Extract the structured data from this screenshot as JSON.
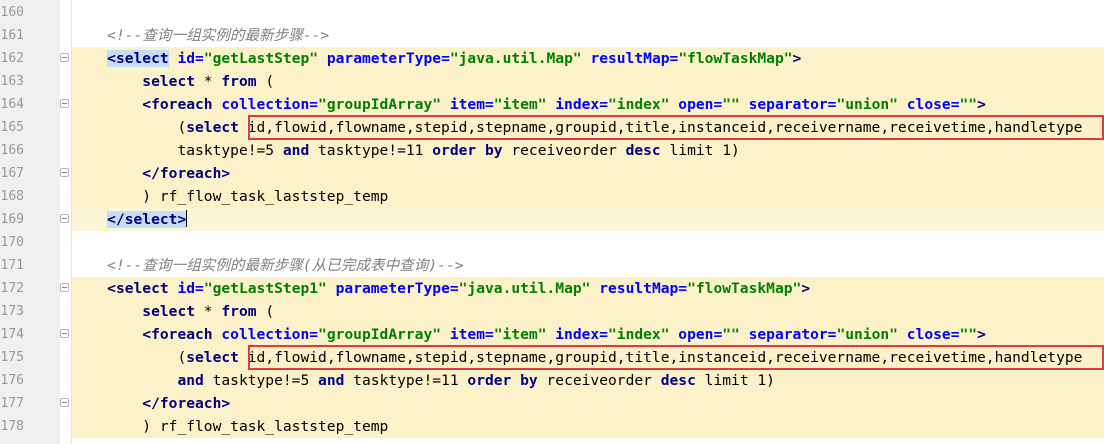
{
  "line_numbers": [
    "160",
    "161",
    "162",
    "163",
    "164",
    "165",
    "166",
    "167",
    "168",
    "169",
    "170",
    "171",
    "172",
    "173",
    "174",
    "175",
    "176",
    "177",
    "178"
  ],
  "code": {
    "l161_comment": "<!--查询一组实例的最新步骤-->",
    "l162": {
      "open": "<select",
      "a1": " id=",
      "v1": "\"getLastStep\"",
      "a2": " parameterType=",
      "v2": "\"java.util.Map\"",
      "a3": " resultMap=",
      "v3": "\"flowTaskMap\"",
      "close": ">"
    },
    "l163": {
      "kw1": "select",
      "t1": " * ",
      "kw2": "from",
      "t2": " ("
    },
    "l164": {
      "open": "<foreach",
      "a1": " collection=",
      "v1": "\"groupIdArray\"",
      "a2": " item=",
      "v2": "\"item\"",
      "a3": " index=",
      "v3": "\"index\"",
      "a4": " open=",
      "v4": "\"\"",
      "a5": " separator=",
      "v5": "\"union\"",
      "a6": " close=",
      "v6": "\"\"",
      "close": ">"
    },
    "l165": {
      "t1": "(",
      "kw1": "select",
      "t2": " id,flowid,flowname,stepid,stepname,groupid,title,instanceid,receivername,receivetime,handletype"
    },
    "l166": {
      "t1": "tasktype!=5 ",
      "kw1": "and",
      "t2": " tasktype!=11 ",
      "kw2": "order",
      "t3": " ",
      "kw3": "by",
      "t4": " receiveorder ",
      "kw4": "desc",
      "t5": " limit 1)"
    },
    "l167": "</foreach>",
    "l168": ") rf_flow_task_laststep_temp",
    "l169": "</select>",
    "l171_comment": "<!--查询一组实例的最新步骤(从已完成表中查询)-->",
    "l172": {
      "open": "<select",
      "a1": " id=",
      "v1": "\"getLastStep1\"",
      "a2": " parameterType=",
      "v2": "\"java.util.Map\"",
      "a3": " resultMap=",
      "v3": "\"flowTaskMap\"",
      "close": ">"
    },
    "l173": {
      "kw1": "select",
      "t1": " * ",
      "kw2": "from",
      "t2": " ("
    },
    "l174": {
      "open": "<foreach",
      "a1": " collection=",
      "v1": "\"groupIdArray\"",
      "a2": " item=",
      "v2": "\"item\"",
      "a3": " index=",
      "v3": "\"index\"",
      "a4": " open=",
      "v4": "\"\"",
      "a5": " separator=",
      "v5": "\"union\"",
      "a6": " close=",
      "v6": "\"\"",
      "close": ">"
    },
    "l175": {
      "t1": "(",
      "kw1": "select",
      "t2": " id,flowid,flowname,stepid,stepname,groupid,title,instanceid,receivername,receivetime,handletype"
    },
    "l176": {
      "kw0": "and",
      "t1": " tasktype!=5 ",
      "kw1": "and",
      "t2": " tasktype!=11 ",
      "kw2": "order",
      "t3": " ",
      "kw3": "by",
      "t4": " receiveorder ",
      "kw4": "desc",
      "t5": " limit 1)"
    },
    "l177": "</foreach>",
    "l178": ") rf_flow_task_laststep_temp"
  },
  "colors": {
    "highlight": "#fbf2c9",
    "selection": "#c7dcf6",
    "annotation_box": "#e33b3b",
    "tag": "#000080",
    "attribute": "#0000ff",
    "string": "#008000",
    "comment": "#808080"
  }
}
